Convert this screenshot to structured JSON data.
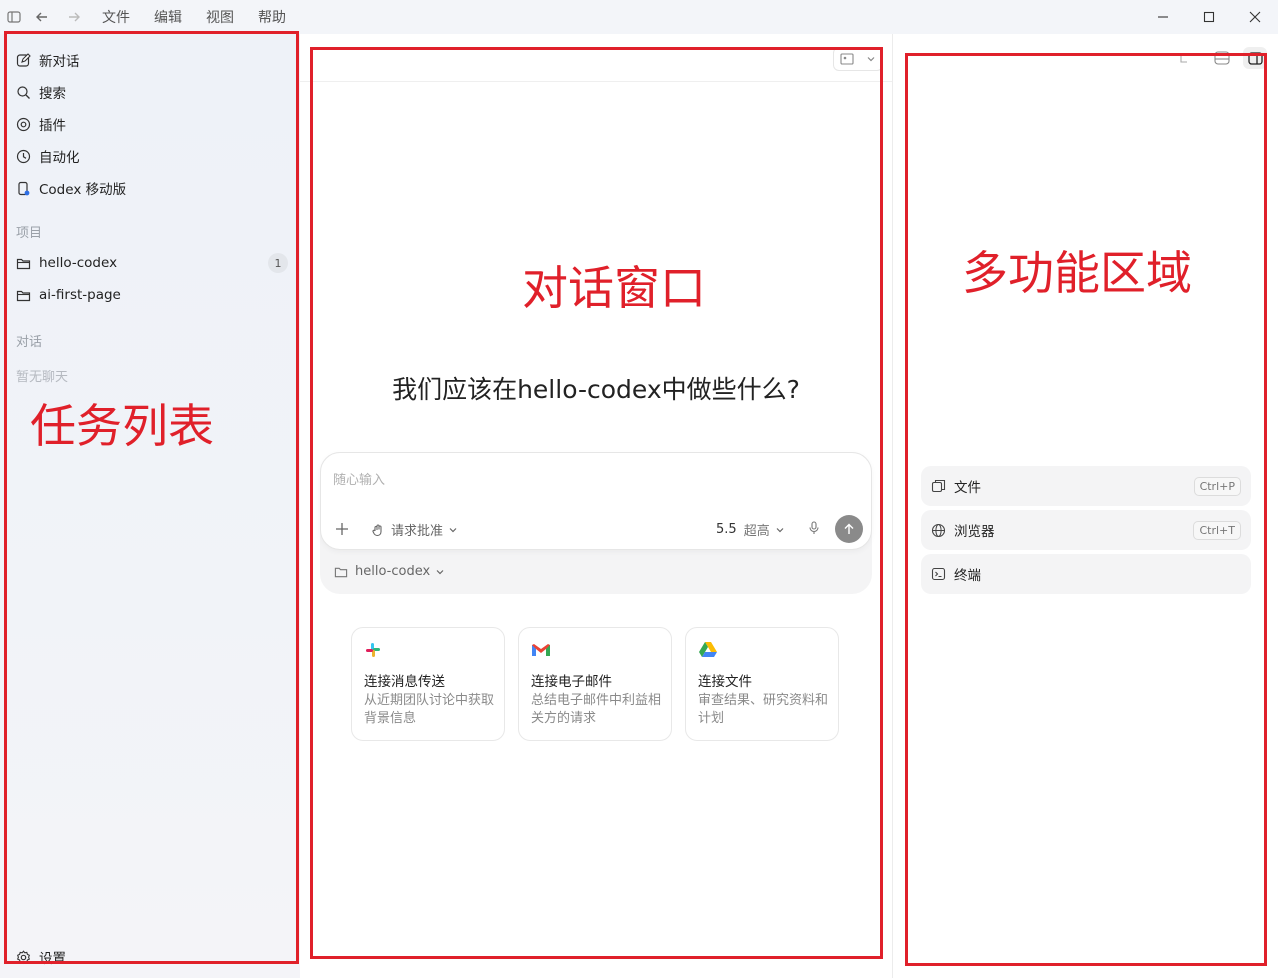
{
  "menu": [
    "文件",
    "编辑",
    "视图",
    "帮助"
  ],
  "sidebar": {
    "nav": [
      "新对话",
      "搜索",
      "插件",
      "自动化",
      "Codex 移动版"
    ],
    "projects_header": "项目",
    "projects": [
      {
        "name": "hello-codex",
        "badge": "1"
      },
      {
        "name": "ai-first-page",
        "badge": ""
      }
    ],
    "chats_header": "对话",
    "chats_empty": "暂无聊天",
    "settings": "设置"
  },
  "main": {
    "heading": "我们应该在hello-codex中做些什么?",
    "composer": {
      "placeholder": "随心输入",
      "approval": "请求批准",
      "model": "5.5",
      "effort": "超高",
      "project": "hello-codex"
    },
    "cards": [
      {
        "title": "连接消息传送",
        "desc": "从近期团队讨论中获取背景信息"
      },
      {
        "title": "连接电子邮件",
        "desc": "总结电子邮件中利益相关方的请求"
      },
      {
        "title": "连接文件",
        "desc": "审查结果、研究资料和计划"
      }
    ]
  },
  "right": {
    "tools": [
      {
        "label": "文件",
        "shortcut": "Ctrl+P"
      },
      {
        "label": "浏览器",
        "shortcut": "Ctrl+T"
      },
      {
        "label": "终端",
        "shortcut": ""
      }
    ]
  },
  "annotations": {
    "sidebar": "任务列表",
    "main": "对话窗口",
    "right": "多功能区域"
  },
  "colors": {
    "annotation": "#e0202a",
    "sidebar_bg": "#eef2f8",
    "send_button": "#8a8a8a"
  }
}
